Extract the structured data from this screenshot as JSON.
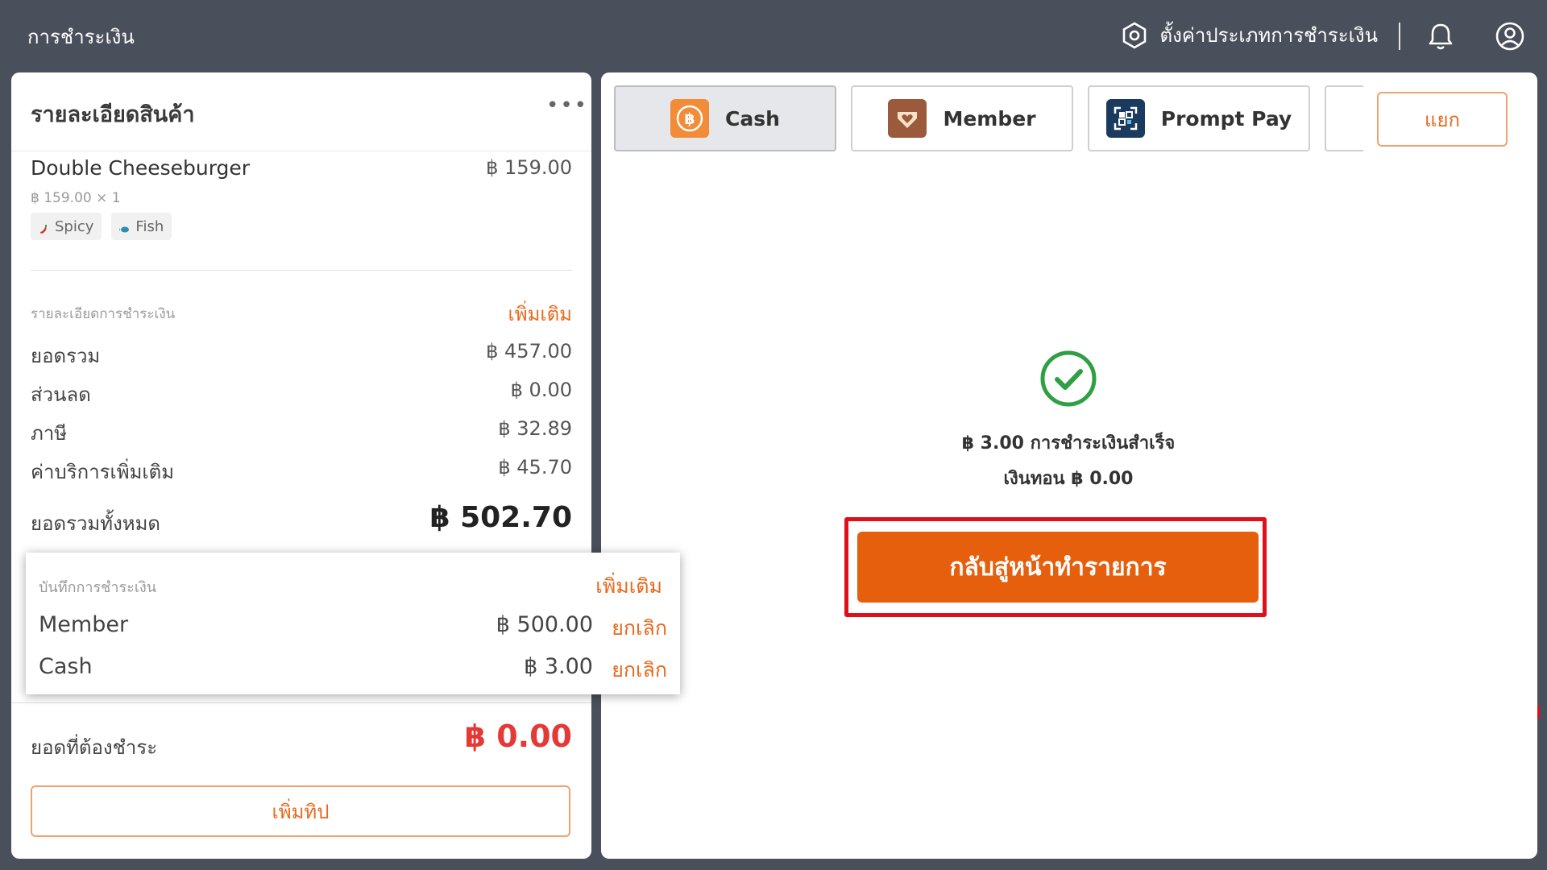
{
  "header": {
    "title": "การชำระเงิน",
    "settings_label": "ตั้งค่าประเภทการชำระเงิน"
  },
  "order": {
    "title": "รายละเอียดสินค้า",
    "more_label": "•••",
    "item": {
      "name": "Double Cheeseburger",
      "price": "฿ 159.00",
      "qty_line": "฿ 159.00 × 1",
      "tags": [
        "Spicy",
        "Fish"
      ]
    }
  },
  "payment_details": {
    "label": "รายละเอียดการชำระเงิน",
    "add_more": "เพิ่มเติม",
    "rows": [
      {
        "k": "ยอดรวม",
        "v": "฿ 457.00"
      },
      {
        "k": "ส่วนลด",
        "v": "฿ 0.00"
      },
      {
        "k": "ภาษี",
        "v": "฿ 32.89"
      },
      {
        "k": "ค่าบริการเพิ่มเติม",
        "v": "฿ 45.70"
      }
    ],
    "grand_total_label": "ยอดรวมทั้งหมด",
    "grand_total": "฿ 502.70"
  },
  "payment_records": {
    "label": "บันทึกการชำระเงิน",
    "add_more": "เพิ่มเติม",
    "rows": [
      {
        "method": "Member",
        "amount": "฿ 500.00",
        "cancel": "ยกเลิก"
      },
      {
        "method": "Cash",
        "amount": "฿ 3.00",
        "cancel": "ยกเลิก"
      }
    ]
  },
  "due": {
    "label": "ยอดที่ต้องชำระ",
    "amount": "฿ 0.00"
  },
  "tip_button": "เพิ่มทิป",
  "methods": [
    {
      "label": "Cash",
      "icon": "baht-coin-icon",
      "active": true
    },
    {
      "label": "Member",
      "icon": "member-heart-icon",
      "active": false
    },
    {
      "label": "Prompt Pay",
      "icon": "qr-scan-icon",
      "active": false
    }
  ],
  "split_button": "แยก",
  "result": {
    "success_text": "฿ 3.00 การชำระเงินสำเร็จ",
    "change_text": "เงินทอน ฿ 0.00",
    "back_button": "กลับสู่หน้าทำรายการ"
  },
  "colors": {
    "accent": "#e55f0d",
    "highlight": "#e0101a",
    "success": "#2ea043",
    "due": "#e53935"
  }
}
